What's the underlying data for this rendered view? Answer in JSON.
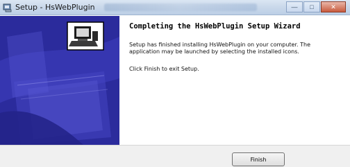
{
  "window": {
    "title": "Setup - HsWebPlugin",
    "controls": {
      "minimize_icon": "minimize-icon",
      "maximize_icon": "maximize-icon",
      "close_icon": "close-icon"
    }
  },
  "content": {
    "heading": "Completing the HsWebPlugin Setup Wizard",
    "paragraph1": "Setup has finished installing HsWebPlugin on your computer. The application may be launched by selecting the installed icons.",
    "paragraph2": "Click Finish to exit Setup."
  },
  "footer": {
    "finish_label": "Finish"
  },
  "colors": {
    "banner_bg": "#2d2da0",
    "banner_shape": "#4b4bc7",
    "title_gradient_top": "#dbe6f3",
    "close_button": "#c85a3d"
  }
}
